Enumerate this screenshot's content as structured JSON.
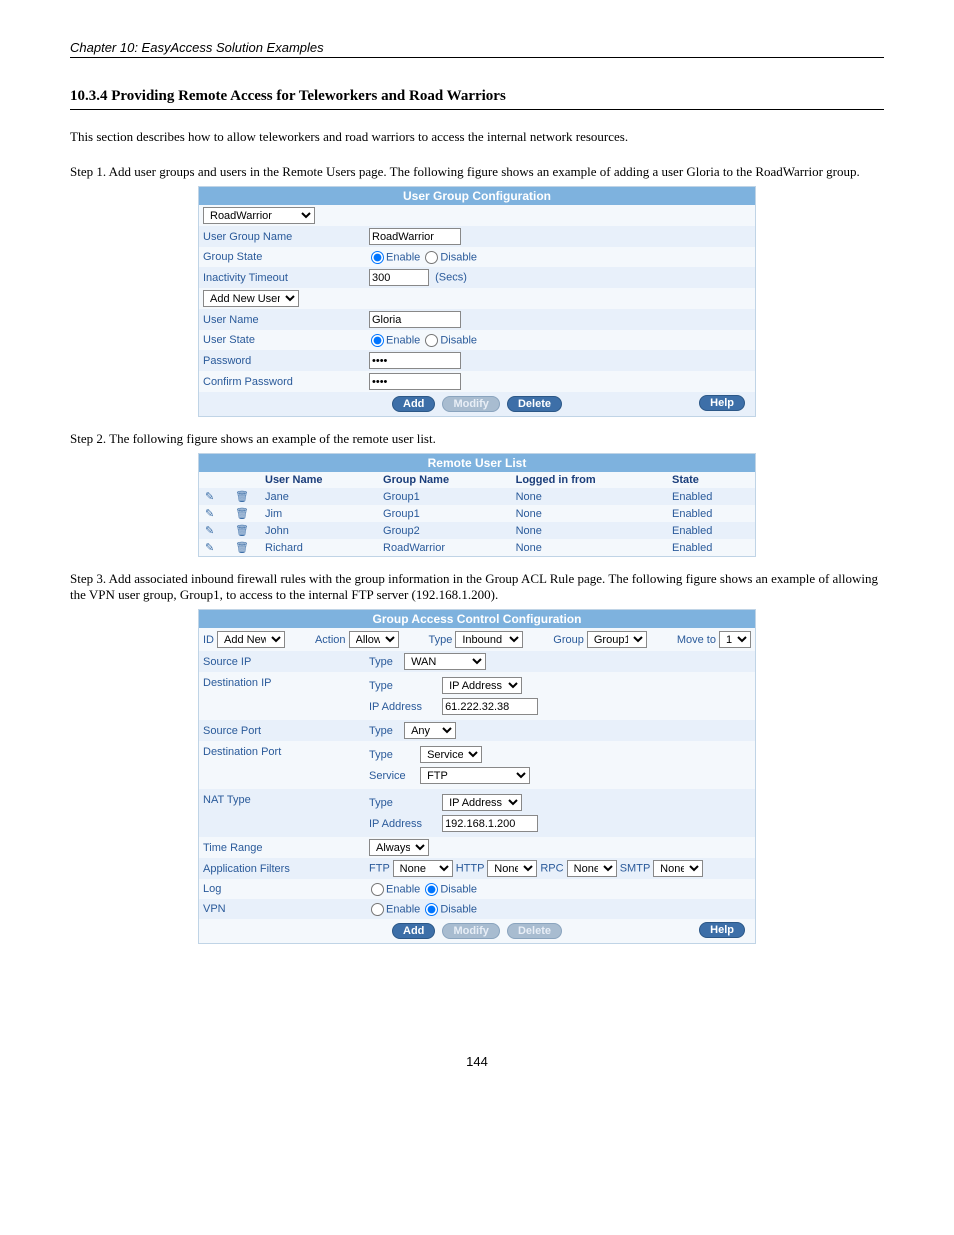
{
  "page_header": "Chapter 10: EasyAccess Solution Examples",
  "section_heading": "10.3.4 Providing Remote Access for Teleworkers and Road Warriors",
  "section_body": "This section describes how to allow teleworkers and road warriors to access the internal network resources.",
  "step1": "Step 1. Add user groups and users in the Remote Users page. The following figure shows an example of adding a user Gloria to the RoadWarrior group.",
  "step2": "Step 2. The following figure shows an example of the remote user list.",
  "step3": "Step 3. Add associated inbound firewall rules with the group information in the Group ACL Rule page. The following figure shows an example of allowing the VPN user group, Group1, to access to the internal FTP server (192.168.1.200).",
  "ugc": {
    "title": "User Group Configuration",
    "group_select": "RoadWarrior",
    "labels": {
      "groupName": "User Group Name",
      "groupState": "Group State",
      "inactivity": "Inactivity Timeout",
      "addUserSel": "Add New User",
      "userName": "User Name",
      "userState": "User State",
      "password": "Password",
      "confirm": "Confirm Password"
    },
    "values": {
      "groupName": "RoadWarrior",
      "inactivity": "300",
      "inactivityUnit": "(Secs)",
      "userName": "Gloria",
      "password": "****",
      "confirm": "****"
    },
    "radio": {
      "enable": "Enable",
      "disable": "Disable"
    },
    "buttons": {
      "add": "Add",
      "modify": "Modify",
      "delete": "Delete",
      "help": "Help"
    }
  },
  "rul": {
    "title": "Remote User List",
    "headers": {
      "user": "User Name",
      "group": "Group Name",
      "logged": "Logged in from",
      "state": "State"
    },
    "rows": [
      {
        "user": "Jane",
        "group": "Group1",
        "logged": "None",
        "state": "Enabled"
      },
      {
        "user": "Jim",
        "group": "Group1",
        "logged": "None",
        "state": "Enabled"
      },
      {
        "user": "John",
        "group": "Group2",
        "logged": "None",
        "state": "Enabled"
      },
      {
        "user": "Richard",
        "group": "RoadWarrior",
        "logged": "None",
        "state": "Enabled"
      }
    ]
  },
  "gacc": {
    "title": "Group Access Control Configuration",
    "top": {
      "idLabel": "ID",
      "idSel": "Add New",
      "actionLabel": "Action",
      "actionSel": "Allow",
      "typeLabel": "Type",
      "typeSel": "Inbound",
      "groupLabel": "Group",
      "groupSel": "Group1",
      "moveLabel": "Move to",
      "moveSel": "1"
    },
    "rows": {
      "srcIP": {
        "label": "Source IP",
        "typeLabel": "Type",
        "typeSel": "WAN"
      },
      "dstIP": {
        "label": "Destination IP",
        "typeLabel": "Type",
        "typeSel": "IP Address",
        "ipLabel": "IP Address",
        "ip": "61.222.32.38"
      },
      "srcPort": {
        "label": "Source Port",
        "typeLabel": "Type",
        "typeSel": "Any"
      },
      "dstPort": {
        "label": "Destination Port",
        "typeLabel": "Type",
        "typeSel": "Service",
        "serviceLabel": "Service",
        "serviceSel": "FTP"
      },
      "nat": {
        "label": "NAT Type",
        "typeLabel": "Type",
        "typeSel": "IP Address",
        "ipLabel": "IP Address",
        "ip": "192.168.1.200"
      },
      "timeRange": {
        "label": "Time Range",
        "sel": "Always"
      },
      "appFilters": {
        "label": "Application Filters",
        "ftp": "FTP",
        "ftpSel": "None",
        "http": "HTTP",
        "httpSel": "None",
        "rpc": "RPC",
        "rpcSel": "None",
        "smtp": "SMTP",
        "smtpSel": "None"
      },
      "log": {
        "label": "Log"
      },
      "vpn": {
        "label": "VPN"
      }
    },
    "radio": {
      "enable": "Enable",
      "disable": "Disable"
    },
    "buttons": {
      "add": "Add",
      "modify": "Modify",
      "delete": "Delete",
      "help": "Help"
    }
  },
  "page_number": "144"
}
